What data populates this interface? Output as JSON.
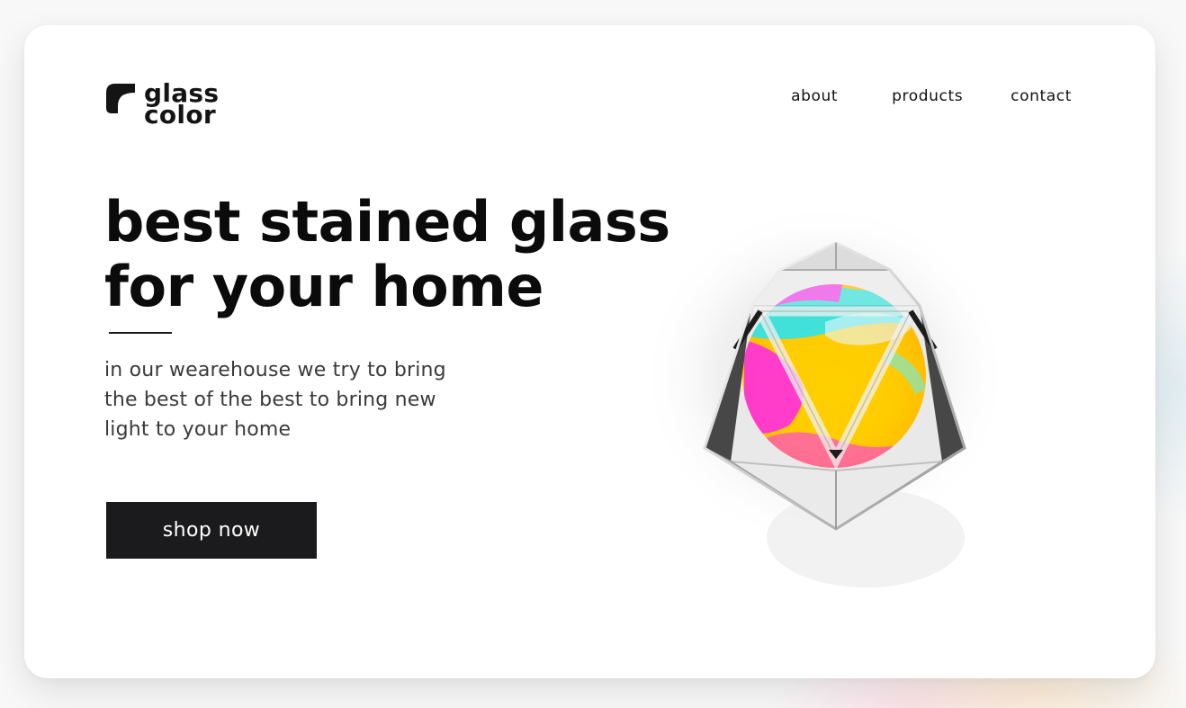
{
  "brand": {
    "name_line1": "glass",
    "name_line2": "color",
    "logo_icon": "glass-color-logo-icon"
  },
  "nav": {
    "items": [
      {
        "label": "about"
      },
      {
        "label": "products"
      },
      {
        "label": "contact"
      }
    ]
  },
  "hero": {
    "headline_line1": "best stained glass",
    "headline_line2": "for your home",
    "description_line1": "in our wearehouse we try to bring",
    "description_line2": "the best of the best to bring new",
    "description_line3": "light to your home",
    "cta_label": "shop now",
    "image": "iridescent-glass-icosahedron"
  },
  "colors": {
    "text": "#0b0b0b",
    "button_bg": "#1b1b1d",
    "button_text": "#ffffff",
    "card_bg": "#ffffff"
  }
}
